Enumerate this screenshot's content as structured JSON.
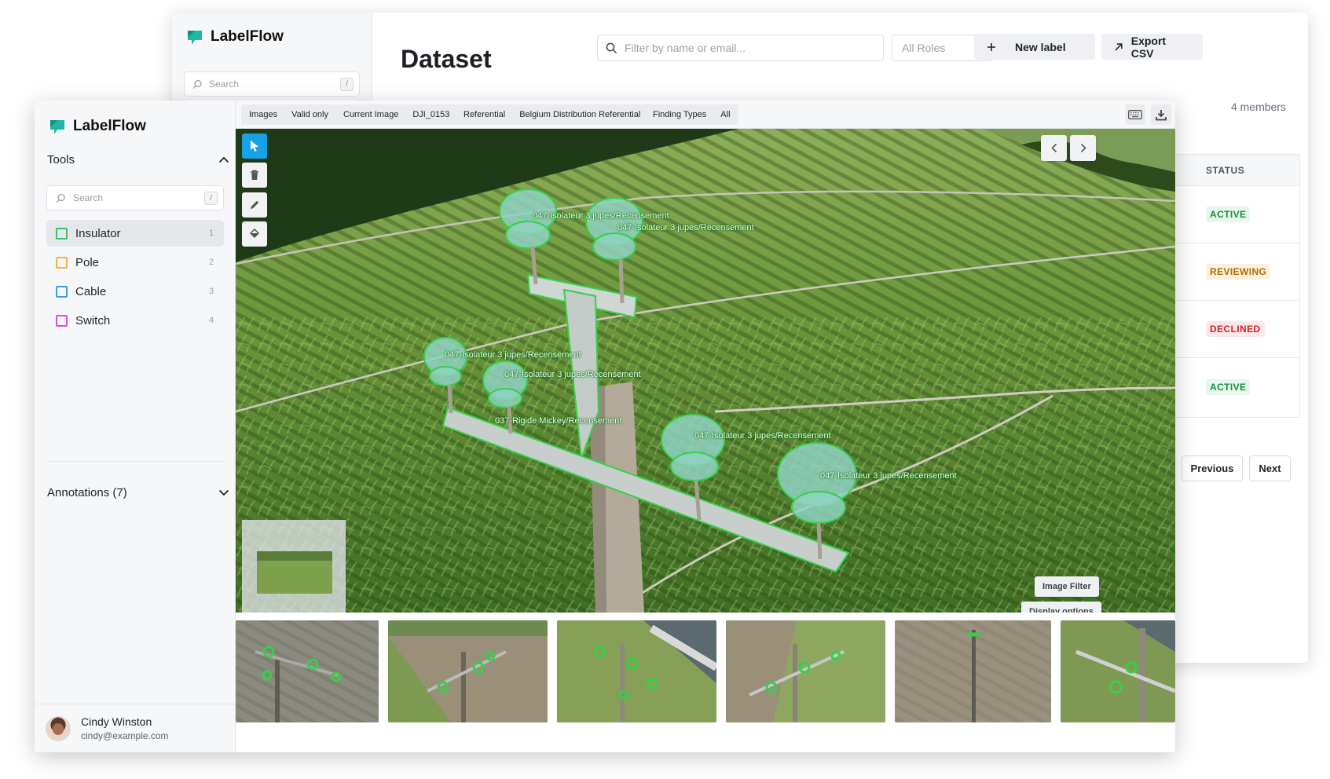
{
  "app": {
    "name": "LabelFlow",
    "brand_color": "#1fb7a4"
  },
  "back_window": {
    "search_placeholder": "Search",
    "search_shortcut": "/",
    "page_title": "Dataset",
    "filter_placeholder": "Filter by name or email...",
    "roles_select": "All Roles",
    "new_label_button": "New label",
    "export_button": "Export CSV",
    "member_count": "4 members",
    "status_header": "STATUS",
    "statuses": [
      {
        "text": "ACTIVE",
        "kind": "active"
      },
      {
        "text": "REVIEWING",
        "kind": "reviewing"
      },
      {
        "text": "DECLINED",
        "kind": "declined"
      },
      {
        "text": "ACTIVE",
        "kind": "active"
      }
    ],
    "previous_button": "Previous",
    "next_button": "Next"
  },
  "front_window": {
    "tools_header": "Tools",
    "tools_search_placeholder": "Search",
    "tools_search_shortcut": "/",
    "labels": [
      {
        "name": "Insulator",
        "key": "1",
        "color": "#3fbf6a",
        "selected": true
      },
      {
        "name": "Pole",
        "key": "2",
        "color": "#f0b53f",
        "selected": false
      },
      {
        "name": "Cable",
        "key": "3",
        "color": "#3d9be9",
        "selected": false
      },
      {
        "name": "Switch",
        "key": "4",
        "color": "#e04fc9",
        "selected": false
      }
    ],
    "annotations_header": "Annotations (7)",
    "user": {
      "name": "Cindy Winston",
      "email": "cindy@example.com"
    },
    "toolbar": {
      "chips": [
        {
          "key": "Images",
          "value": "Valid only"
        },
        {
          "key": "Current Image",
          "value": "DJI_0153"
        },
        {
          "key": "Referential",
          "value": "Belgium Distribution Referential"
        },
        {
          "key": "Finding Types",
          "value": "All"
        }
      ]
    },
    "annotations": [
      "047-Isolateur 3 jupes/Recensement",
      "047-Isolateur 3 jupes/Recensement",
      "047-Isolateur 3 jupes/Recensement",
      "047-Isolateur 3 jupes/Recensement",
      "037-Rigide Mickey/Recensement",
      "047-Isolateur 3 jupes/Recensement",
      "047-Isolateur 3 jupes/Recensement"
    ],
    "image_filter_button": "Image Filter",
    "display_options_button": "Display options",
    "annotation_color": "#35d04a"
  }
}
